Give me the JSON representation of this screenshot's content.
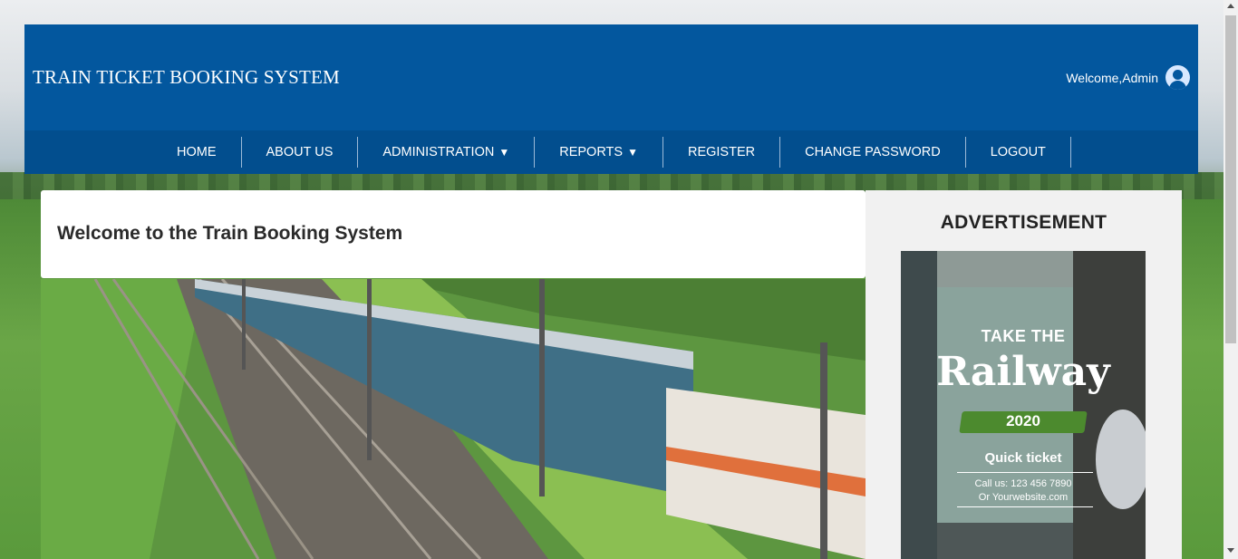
{
  "header": {
    "site_title": "TRAIN TICKET BOOKING SYSTEM",
    "welcome_text": "Welcome,Admin",
    "avatar_icon": "user-avatar-icon"
  },
  "nav": {
    "items": [
      {
        "label": "HOME"
      },
      {
        "label": "ABOUT US"
      },
      {
        "label": "ADMINISTRATION",
        "caret": "▼"
      },
      {
        "label": "REPORTS",
        "caret": "▼"
      },
      {
        "label": "REGISTER"
      },
      {
        "label": "CHANGE PASSWORD"
      },
      {
        "label": "LOGOUT"
      }
    ]
  },
  "main": {
    "welcome_heading": "Welcome to the Train Booking System",
    "hero_image": "train-photo"
  },
  "advertisement": {
    "title": "ADVERTISEMENT",
    "take_the": "TAKE THE",
    "railway": "Railway",
    "year": "2020",
    "quick_ticket": "Quick ticket",
    "call": "Call us: 123 456 7890",
    "website": "Or Yourwebsite.com"
  },
  "colors": {
    "header_bg": "#03579e",
    "nav_bg": "#024e8e",
    "ad_panel_bg": "#f1f1f1"
  }
}
